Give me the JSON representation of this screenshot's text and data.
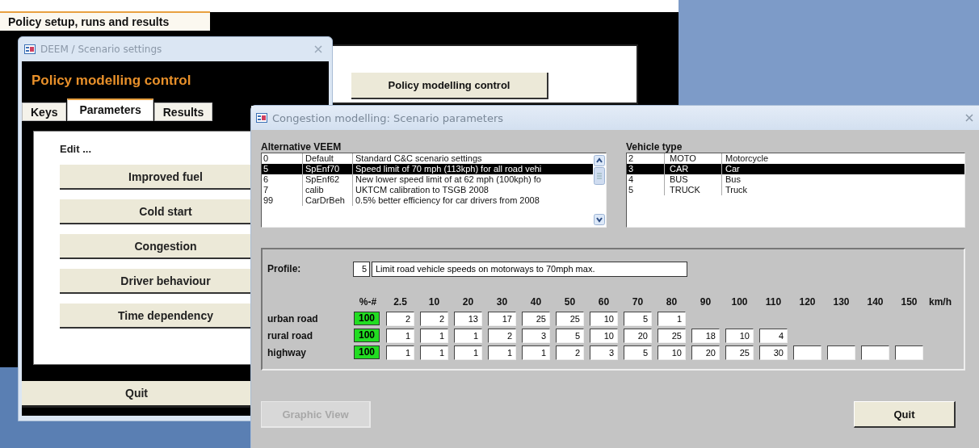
{
  "app_tab": {
    "label": "Policy setup, runs and results"
  },
  "background_form": {
    "button": "Policy modelling control"
  },
  "scenario_window": {
    "title": "DEEM / Scenario settings",
    "heading": "Policy modelling control",
    "tabs": [
      {
        "label": "Keys",
        "selected": false
      },
      {
        "label": "Parameters",
        "selected": true
      },
      {
        "label": "Results",
        "selected": false
      }
    ],
    "edit_label": "Edit ...",
    "buttons": [
      "Improved fuel",
      "Cold start",
      "Congestion",
      "Driver behaviour",
      "Time dependency"
    ],
    "quit": "Quit"
  },
  "congestion_window": {
    "title": "Congestion modelling: Scenario parameters",
    "veem": {
      "label": "Alternative VEEM",
      "rows": [
        {
          "id": "0",
          "code": "Default",
          "description": "Standard C&C scenario settings",
          "selected": false
        },
        {
          "id": "5",
          "code": "SpEnf70",
          "description": "Speed limit of 70 mph (113kph) for all road vehi",
          "selected": true
        },
        {
          "id": "6",
          "code": "SpEnf62",
          "description": "New lower speed limit of at 62 mph (100kph) fo",
          "selected": false
        },
        {
          "id": "7",
          "code": "calib",
          "description": "UKTCM calibration to TSGB 2008",
          "selected": false
        },
        {
          "id": "99",
          "code": "CarDrBeh",
          "description": "0.5% better efficiency for car drivers from 2008",
          "selected": false
        }
      ]
    },
    "vehicle_type": {
      "label": "Vehicle type",
      "rows": [
        {
          "id": "2",
          "code": "MOTO",
          "description": "Motorcycle",
          "selected": false
        },
        {
          "id": "3",
          "code": "CAR",
          "description": "Car",
          "selected": true
        },
        {
          "id": "4",
          "code": "BUS",
          "description": "Bus",
          "selected": false
        },
        {
          "id": "5",
          "code": "TRUCK",
          "description": "Truck",
          "selected": false
        }
      ]
    },
    "profile": {
      "label": "Profile:",
      "number": "5",
      "description": "Limit road vehicle speeds on motorways to 70mph max."
    },
    "speed_table": {
      "share_header": "%-#",
      "speeds": [
        "2.5",
        "10",
        "20",
        "30",
        "40",
        "50",
        "60",
        "70",
        "80",
        "90",
        "100",
        "110",
        "120",
        "130",
        "140",
        "150"
      ],
      "unit": "km/h",
      "rows": [
        {
          "label": "urban road",
          "share": "100",
          "cells": [
            {
              "kind": "value",
              "text": "2"
            },
            {
              "kind": "value",
              "text": "2"
            },
            {
              "kind": "value",
              "text": "13"
            },
            {
              "kind": "value",
              "text": "17"
            },
            {
              "kind": "value",
              "text": "25"
            },
            {
              "kind": "value",
              "text": "25"
            },
            {
              "kind": "value",
              "text": "10"
            },
            {
              "kind": "value",
              "text": "5"
            },
            {
              "kind": "value",
              "text": "1"
            }
          ]
        },
        {
          "label": "rural road",
          "share": "100",
          "cells": [
            {
              "kind": "value",
              "text": "1"
            },
            {
              "kind": "value",
              "text": "1"
            },
            {
              "kind": "value",
              "text": "1"
            },
            {
              "kind": "value",
              "text": "2"
            },
            {
              "kind": "value",
              "text": "3"
            },
            {
              "kind": "value",
              "text": "5"
            },
            {
              "kind": "value",
              "text": "10"
            },
            {
              "kind": "value",
              "text": "20"
            },
            {
              "kind": "value",
              "text": "25"
            },
            {
              "kind": "value",
              "text": "18"
            },
            {
              "kind": "value",
              "text": "10"
            },
            {
              "kind": "value",
              "text": "4"
            }
          ]
        },
        {
          "label": "highway",
          "share": "100",
          "cells": [
            {
              "kind": "value",
              "text": "1"
            },
            {
              "kind": "value",
              "text": "1"
            },
            {
              "kind": "value",
              "text": "1"
            },
            {
              "kind": "value",
              "text": "1"
            },
            {
              "kind": "value",
              "text": "1"
            },
            {
              "kind": "value",
              "text": "2"
            },
            {
              "kind": "value",
              "text": "3"
            },
            {
              "kind": "value",
              "text": "5"
            },
            {
              "kind": "value",
              "text": "10"
            },
            {
              "kind": "value",
              "text": "20"
            },
            {
              "kind": "value",
              "text": "25"
            },
            {
              "kind": "value",
              "text": "30"
            },
            {
              "kind": "blank"
            },
            {
              "kind": "blank"
            },
            {
              "kind": "blank"
            },
            {
              "kind": "blank"
            }
          ]
        }
      ]
    },
    "graphic_view": {
      "label": "Graphic View",
      "disabled": true
    },
    "quit": "Quit"
  }
}
